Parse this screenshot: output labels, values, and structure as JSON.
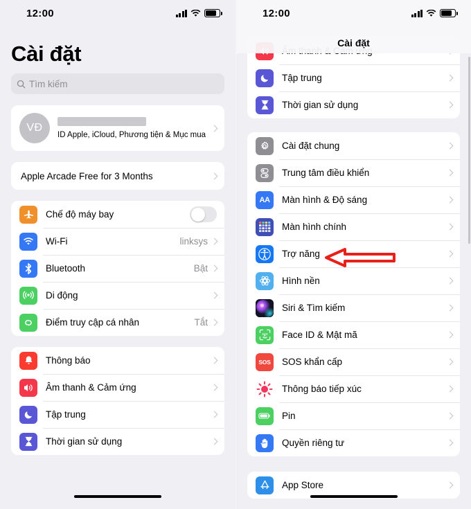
{
  "statusbar": {
    "time": "12:00",
    "signal_icon": "cellular-signal-icon",
    "wifi_icon": "wifi-icon",
    "battery_icon": "battery-icon"
  },
  "left": {
    "title": "Cài đặt",
    "search": {
      "placeholder": "Tìm kiếm",
      "icon": "search-icon"
    },
    "account": {
      "initials": "VĐ",
      "name_redacted": "",
      "subtitle": "ID Apple, iCloud, Phương tiện & Mục mua"
    },
    "promo": {
      "label": "Apple Arcade Free for 3 Months"
    },
    "connectivity": [
      {
        "label": "Chế độ máy bay",
        "icon": "airplane-icon",
        "color": "#f0902b",
        "control": "toggle",
        "toggle_on": false
      },
      {
        "label": "Wi-Fi",
        "icon": "wifi-icon",
        "color": "#3478f6",
        "value": "linksys"
      },
      {
        "label": "Bluetooth",
        "icon": "bluetooth-icon",
        "color": "#3478f6",
        "value": "Bật"
      },
      {
        "label": "Di động",
        "icon": "cellular-icon",
        "color": "#4cd062",
        "value": ""
      },
      {
        "label": "Điểm truy cập cá nhân",
        "icon": "hotspot-icon",
        "color": "#4cd062",
        "value": "Tắt"
      }
    ],
    "notifications": [
      {
        "label": "Thông báo",
        "icon": "bell-icon",
        "color": "#fb3b30"
      },
      {
        "label": "Âm thanh & Cảm ứng",
        "icon": "speaker-icon",
        "color": "#f4374a"
      },
      {
        "label": "Tập trung",
        "icon": "moon-icon",
        "color": "#5a57d6"
      },
      {
        "label": "Thời gian sử dụng",
        "icon": "hourglass-icon",
        "color": "#5a57d6"
      }
    ]
  },
  "right": {
    "nav_title": "Cài đặt",
    "clipped_group": [
      {
        "label": "Âm thanh & Cảm ứng",
        "icon": "speaker-icon",
        "color": "#f4374a"
      },
      {
        "label": "Tập trung",
        "icon": "moon-icon",
        "color": "#5a57d6"
      },
      {
        "label": "Thời gian sử dụng",
        "icon": "hourglass-icon",
        "color": "#5a57d6"
      }
    ],
    "system": [
      {
        "label": "Cài đặt chung",
        "icon": "gear-icon",
        "color": "#8e8e93"
      },
      {
        "label": "Trung tâm điều khiển",
        "icon": "control-center-icon",
        "color": "#8e8e93"
      },
      {
        "label": "Màn hình & Độ sáng",
        "icon": "display-brightness-icon",
        "color": "#3478f6"
      },
      {
        "label": "Màn hình chính",
        "icon": "home-screen-icon",
        "color": "#3f4fb5"
      },
      {
        "label": "Trợ năng",
        "icon": "accessibility-icon",
        "color": "#1678f2"
      },
      {
        "label": "Hình nền",
        "icon": "wallpaper-icon",
        "color": "#52b0ef"
      },
      {
        "label": "Siri & Tìm kiếm",
        "icon": "siri-icon",
        "color": "#111122"
      },
      {
        "label": "Face ID & Mật mã",
        "icon": "face-id-icon",
        "color": "#4cd062"
      },
      {
        "label": "SOS khẩn cấp",
        "icon": "sos-icon",
        "color": "#f0473e"
      },
      {
        "label": "Thông báo tiếp xúc",
        "icon": "exposure-notification-icon",
        "color": "#ffffff"
      },
      {
        "label": "Pin",
        "icon": "battery-icon",
        "color": "#4cd062"
      },
      {
        "label": "Quyền riêng tư",
        "icon": "privacy-hand-icon",
        "color": "#3478f6"
      }
    ],
    "store": [
      {
        "label": "App Store",
        "icon": "app-store-icon",
        "color": "#2e8fe8"
      }
    ]
  },
  "annotation": {
    "arrow": "left-pointing-arrow",
    "color": "#e8201a",
    "points_at": "Trợ năng"
  }
}
